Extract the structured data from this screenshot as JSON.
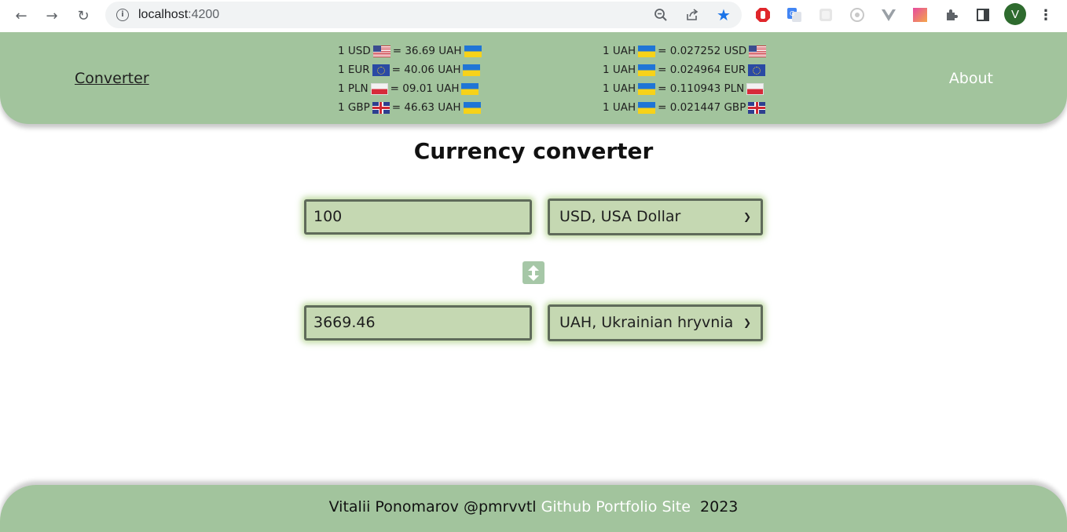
{
  "browser": {
    "url_host": "localhost",
    "url_port": ":4200",
    "avatar_initial": "V",
    "icons": [
      "back-icon",
      "forward-icon",
      "reload-icon",
      "site-info-icon",
      "zoom-icon",
      "share-icon",
      "star-icon",
      "adblock-icon",
      "translate-icon",
      "extension-icon",
      "extension-icon",
      "vue-devtools-icon",
      "color-picker-icon",
      "puzzle-icon",
      "side-panel-icon",
      "menu-icon"
    ]
  },
  "header": {
    "nav_converter": "Converter",
    "nav_about": "About",
    "rates_to_uah": [
      {
        "left": "1 USD",
        "flag_from": "us",
        "mid": "= 36.69 UAH",
        "flag_to": "ua"
      },
      {
        "left": "1 EUR",
        "flag_from": "eu",
        "mid": "= 40.06 UAH",
        "flag_to": "ua"
      },
      {
        "left": "1 PLN",
        "flag_from": "pl",
        "mid": "= 09.01 UAH",
        "flag_to": "ua"
      },
      {
        "left": "1 GBP",
        "flag_from": "gb",
        "mid": "= 46.63 UAH",
        "flag_to": "ua"
      }
    ],
    "rates_from_uah": [
      {
        "left": "1 UAH",
        "flag_from": "ua",
        "mid": "= 0.027252 USD",
        "flag_to": "us"
      },
      {
        "left": "1 UAH",
        "flag_from": "ua",
        "mid": "= 0.024964 EUR",
        "flag_to": "eu"
      },
      {
        "left": "1 UAH",
        "flag_from": "ua",
        "mid": "= 0.110943 PLN",
        "flag_to": "pl"
      },
      {
        "left": "1 UAH",
        "flag_from": "ua",
        "mid": "= 0.021447 GBP",
        "flag_to": "gb"
      }
    ]
  },
  "main": {
    "title": "Currency converter",
    "from_amount": "100",
    "from_currency": "USD, USA Dollar",
    "to_amount": "3669.46",
    "to_currency": "UAH, Ukrainian hryvnia"
  },
  "footer": {
    "author": "Vitalii Ponomarov @pmrvvtl",
    "link_github": "Github",
    "link_portfolio": "Portfolio Site",
    "year": "2023"
  },
  "colors": {
    "header_bg": "#a2c49d",
    "field_bg": "#c5d8b2",
    "field_border": "#5f6b5a"
  }
}
